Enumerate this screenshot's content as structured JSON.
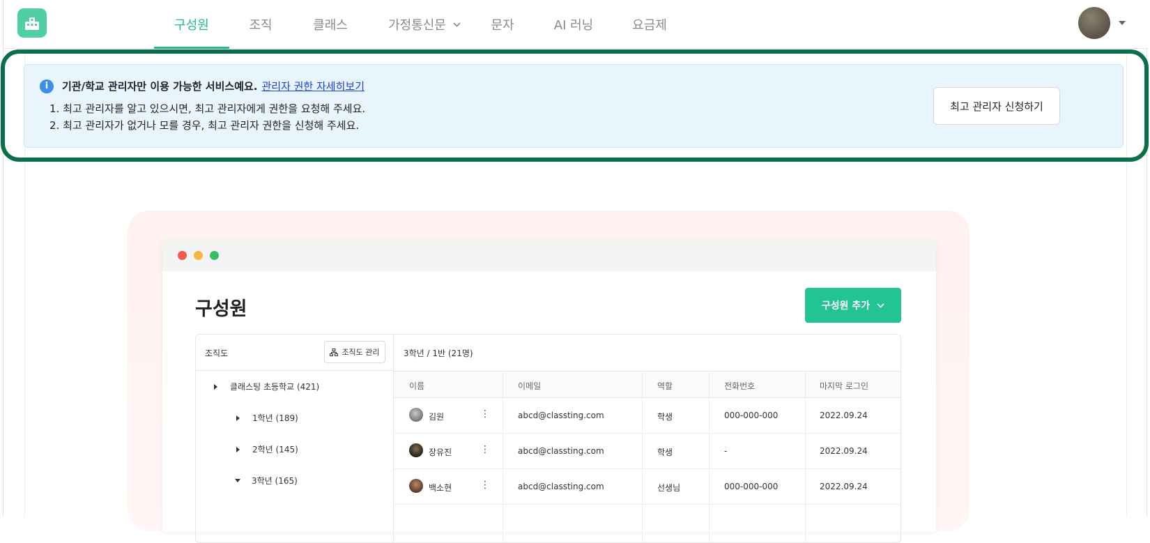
{
  "header": {
    "nav": [
      {
        "label": "구성원",
        "active": true
      },
      {
        "label": "조직",
        "active": false
      },
      {
        "label": "클래스",
        "active": false
      },
      {
        "label": "가정통신문",
        "active": false,
        "has_dropdown": true
      },
      {
        "label": "문자",
        "active": false
      },
      {
        "label": "AI 러닝",
        "active": false
      },
      {
        "label": "요금제",
        "active": false
      }
    ]
  },
  "notice": {
    "headline": "기관/학교 관리자만 이용 가능한 서비스예요.",
    "link": "관리자 권한 자세히보기",
    "line1": "1. 최고 관리자를 알고 있으시면, 최고 관리자에게 권한을 요청해 주세요.",
    "line2": "2. 최고 관리자가 없거나 모를 경우, 최고 관리자 권한을 신청해 주세요.",
    "button": "최고 관리자 신청하기"
  },
  "preview": {
    "title": "구성원",
    "add_button": "구성원 추가",
    "org_title": "조직도",
    "org_button": "조직도 관리",
    "tree": [
      {
        "label": "클래스팅 초등학교 (421)",
        "expanded": false
      },
      {
        "label": "1학년 (189)",
        "expanded": false
      },
      {
        "label": "2학년 (145)",
        "expanded": false
      },
      {
        "label": "3학년 (165)",
        "expanded": true
      }
    ],
    "table_title": "3학년 / 1반 (21명)",
    "columns": [
      "이름",
      "이메일",
      "역할",
      "전화번호",
      "마지막 로그인"
    ],
    "rows": [
      {
        "name": "김원",
        "email": "abcd@classting.com",
        "role": "학생",
        "phone": "000-000-000",
        "last_login": "2022.09.24"
      },
      {
        "name": "장유진",
        "email": "abcd@classting.com",
        "role": "학생",
        "phone": "-",
        "last_login": "2022.09.24"
      },
      {
        "name": "백소현",
        "email": "abcd@classting.com",
        "role": "선생님",
        "phone": "000-000-000",
        "last_login": "2022.09.24"
      }
    ]
  },
  "colors": {
    "brand_green": "#22b98a",
    "highlight_border": "#0b7048",
    "notice_bg": "#e8f5fd",
    "link_blue": "#1a3fe0"
  }
}
